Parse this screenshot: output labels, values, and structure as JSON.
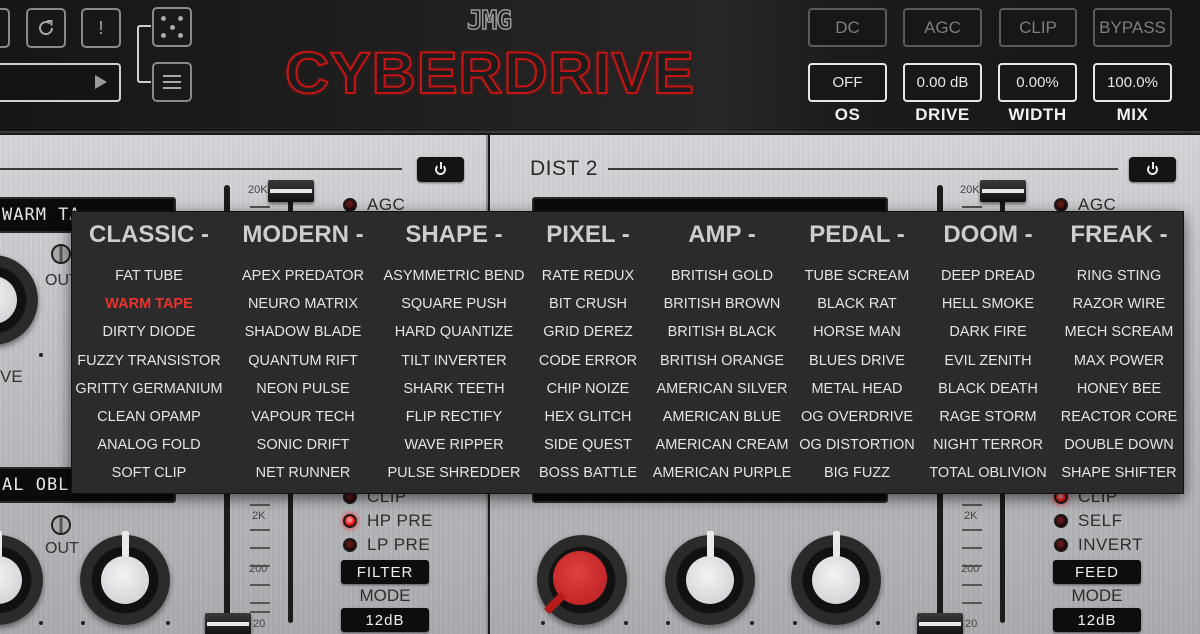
{
  "header": {
    "brand": "JMG",
    "product_title": "CYBERDRIVE",
    "left_buttons": [
      {
        "name": "reload",
        "icon": "refresh-icon"
      },
      {
        "name": "info",
        "icon": "exclamation-icon",
        "glyph": "!"
      },
      {
        "name": "randomize",
        "icon": "dice-icon"
      },
      {
        "name": "preset-menu",
        "icon": "hamburger-menu-icon"
      }
    ],
    "preset_field": {
      "value": "",
      "next_icon": "play-arrow-icon"
    },
    "toggles": [
      {
        "label": "DC",
        "active": false
      },
      {
        "label": "AGC",
        "active": false
      },
      {
        "label": "CLIP",
        "active": false
      },
      {
        "label": "BYPASS",
        "active": false
      }
    ],
    "params": [
      {
        "label": "OS",
        "value": "OFF"
      },
      {
        "label": "DRIVE",
        "value": "0.00 dB"
      },
      {
        "label": "WIDTH",
        "value": "0.00%"
      },
      {
        "label": "MIX",
        "value": "100.0%"
      }
    ]
  },
  "dist1": {
    "algorithm_top": "WARM TA",
    "algorithm_bottom": "AL OBLIV",
    "knob_label_partial": "VE",
    "out_label_top": "OUT",
    "out_label_bottom": "OUT",
    "fader_scale": [
      "20K",
      "2K",
      "200",
      "20"
    ],
    "leds": [
      {
        "label": "AGC",
        "on": false
      },
      {
        "label": "CLIP",
        "on": false
      },
      {
        "label": "HP PRE",
        "on": true
      },
      {
        "label": "LP PRE",
        "on": false
      }
    ],
    "filter_button": "FILTER",
    "mode_label": "MODE",
    "mode_value": "12dB"
  },
  "dist2": {
    "title": "DIST 2",
    "fader_scale": [
      "20K",
      "2K",
      "200",
      "20"
    ],
    "leds": [
      {
        "label": "AGC",
        "on": false
      },
      {
        "label": "CLIP",
        "on": true
      },
      {
        "label": "SELF",
        "on": false
      },
      {
        "label": "INVERT",
        "on": false
      }
    ],
    "feed_button": "FEED",
    "mode_label": "MODE",
    "mode_value": "12dB"
  },
  "algorithm_menu": {
    "selected": "WARM TAPE",
    "selected_color": "#e8332f",
    "categories": [
      {
        "title": "CLASSIC -",
        "items": [
          "FAT TUBE",
          "WARM TAPE",
          "DIRTY DIODE",
          "FUZZY TRANSISTOR",
          "GRITTY GERMANIUM",
          "CLEAN OPAMP",
          "ANALOG FOLD",
          "SOFT CLIP"
        ]
      },
      {
        "title": "MODERN -",
        "items": [
          "APEX PREDATOR",
          "NEURO MATRIX",
          "SHADOW BLADE",
          "QUANTUM RIFT",
          "NEON PULSE",
          "VAPOUR TECH",
          "SONIC DRIFT",
          "NET RUNNER"
        ]
      },
      {
        "title": "SHAPE -",
        "items": [
          "ASYMMETRIC BEND",
          "SQUARE PUSH",
          "HARD QUANTIZE",
          "TILT INVERTER",
          "SHARK TEETH",
          "FLIP RECTIFY",
          "WAVE RIPPER",
          "PULSE SHREDDER"
        ]
      },
      {
        "title": "PIXEL -",
        "items": [
          "RATE REDUX",
          "BIT CRUSH",
          "GRID DEREZ",
          "CODE ERROR",
          "CHIP NOIZE",
          "HEX GLITCH",
          "SIDE QUEST",
          "BOSS BATTLE"
        ]
      },
      {
        "title": "AMP -",
        "items": [
          "BRITISH GOLD",
          "BRITISH BROWN",
          "BRITISH BLACK",
          "BRITISH ORANGE",
          "AMERICAN SILVER",
          "AMERICAN BLUE",
          "AMERICAN CREAM",
          "AMERICAN PURPLE"
        ]
      },
      {
        "title": "PEDAL -",
        "items": [
          "TUBE SCREAM",
          "BLACK RAT",
          "HORSE MAN",
          "BLUES DRIVE",
          "METAL HEAD",
          "OG OVERDRIVE",
          "OG DISTORTION",
          "BIG FUZZ"
        ]
      },
      {
        "title": "DOOM -",
        "items": [
          "DEEP DREAD",
          "HELL SMOKE",
          "DARK FIRE",
          "EVIL ZENITH",
          "BLACK DEATH",
          "RAGE STORM",
          "NIGHT TERROR",
          "TOTAL OBLIVION"
        ]
      },
      {
        "title": "FREAK -",
        "items": [
          "RING STING",
          "RAZOR WIRE",
          "MECH SCREAM",
          "MAX POWER",
          "HONEY BEE",
          "REACTOR CORE",
          "DOUBLE DOWN",
          "SHAPE SHIFTER"
        ]
      }
    ]
  }
}
